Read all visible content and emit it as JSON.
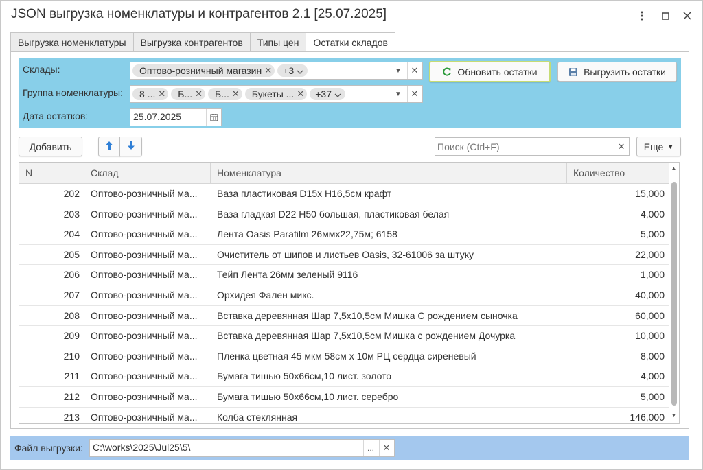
{
  "window": {
    "title": "JSON выгрузка номенклатуры и контрагентов 2.1 [25.07.2025]"
  },
  "tabs": [
    {
      "label": "Выгрузка номенклатуры"
    },
    {
      "label": "Выгрузка контрагентов"
    },
    {
      "label": "Типы цен"
    },
    {
      "label": "Остатки складов"
    }
  ],
  "filter": {
    "warehouses_label": "Склады:",
    "warehouses_chips": [
      "Оптово-розничный магазин"
    ],
    "warehouses_more": "+3",
    "group_label": "Группа номенклатуры:",
    "group_chips": [
      "8 ...",
      "Б...",
      "Б...",
      "Букеты ..."
    ],
    "group_more": "+37",
    "date_label": "Дата остатков:",
    "date_value": "25.07.2025",
    "refresh_button": "Обновить остатки",
    "export_button": "Выгрузить остатки"
  },
  "toolbar": {
    "add_button": "Добавить",
    "search_placeholder": "Поиск (Ctrl+F)",
    "more_button": "Еще"
  },
  "table": {
    "columns": [
      "N",
      "Склад",
      "Номенклатура",
      "Количество"
    ],
    "rows": [
      {
        "n": "202",
        "sklad": "Оптово-розничный ма...",
        "nom": "Ваза пластиковая D15х Н16,5см крафт",
        "qty": "15,000"
      },
      {
        "n": "203",
        "sklad": "Оптово-розничный ма...",
        "nom": "Ваза гладкая D22 H50 большая, пластиковая  белая",
        "qty": "4,000"
      },
      {
        "n": "204",
        "sklad": "Оптово-розничный ма...",
        "nom": "Лента Oasis Parafilm 26ммх22,75м; 6158",
        "qty": "5,000"
      },
      {
        "n": "205",
        "sklad": "Оптово-розничный ма...",
        "nom": "Очиститель от шипов и листьев Oasis, 32-61006 за штуку",
        "qty": "22,000"
      },
      {
        "n": "206",
        "sklad": "Оптово-розничный ма...",
        "nom": "Тейп Лента 26мм зеленый 9116",
        "qty": "1,000"
      },
      {
        "n": "207",
        "sklad": "Оптово-розничный ма...",
        "nom": "Орхидея Фален микс.",
        "qty": "40,000"
      },
      {
        "n": "208",
        "sklad": "Оптово-розничный ма...",
        "nom": "Вставка деревянная  Шар 7,5х10,5см  Мишка С рождением сыночка",
        "qty": "60,000"
      },
      {
        "n": "209",
        "sklad": "Оптово-розничный ма...",
        "nom": "Вставка деревянная  Шар 7,5х10,5см  Мишка с рождением Дочурка",
        "qty": "10,000"
      },
      {
        "n": "210",
        "sklad": "Оптово-розничный ма...",
        "nom": "Пленка цветная 45 мкм 58см х 10м РЦ сердца сиреневый",
        "qty": "8,000"
      },
      {
        "n": "211",
        "sklad": "Оптово-розничный ма...",
        "nom": "Бумага тишью  50х66см,10 лист. золото",
        "qty": "4,000"
      },
      {
        "n": "212",
        "sklad": "Оптово-розничный ма...",
        "nom": "Бумага тишью  50х66см,10 лист. серебро",
        "qty": "5,000"
      },
      {
        "n": "213",
        "sklad": "Оптово-розничный ма...",
        "nom": "Колба стеклянная",
        "qty": "146,000"
      }
    ]
  },
  "footer": {
    "file_label": "Файл выгрузки:",
    "file_value": "C:\\works\\2025\\Jul25\\5\\"
  },
  "colors": {
    "filter_bg": "#88cfe9",
    "footer_bg": "#a4c8ee",
    "refresh_icon": "#2a9a3a",
    "arrow_icon": "#2f7fd6"
  }
}
